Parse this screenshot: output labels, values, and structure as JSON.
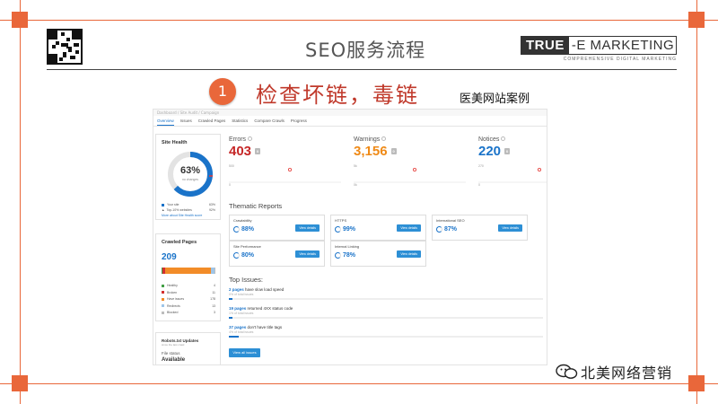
{
  "slide": {
    "title": "SEO服务流程",
    "brand_part1": "TRUE",
    "brand_part2": "-E MARKETING",
    "brand_sub": "COMPREHENSIVE DIGITAL MARKETING",
    "step_number": "1",
    "step_title": "检查坏链，毒链",
    "case_label": "医美网站案例",
    "watermark": "北美网络营销",
    "accent_color": "#e9673a"
  },
  "screenshot": {
    "breadcrumb": "Dashboard  /  Site Audit  /  Campaign",
    "tabs": [
      "Overview",
      "Issues",
      "Crawled Pages",
      "Statistics",
      "Compare Crawls",
      "Progress"
    ],
    "active_tab": 0,
    "site_health": {
      "label": "Site Health",
      "percent": 63,
      "percent_label": "63%",
      "sub": "no changes",
      "legend": [
        {
          "label": "Your site",
          "value": "63%",
          "color": "#1a73c9"
        },
        {
          "label": "Top-10% websites",
          "value": "92%",
          "color": "#4caf50"
        }
      ],
      "link": "More about Site Health score"
    },
    "crawled_pages": {
      "label": "Crawled Pages",
      "count": "209",
      "segments": [
        {
          "label": "Healthy",
          "value": "4",
          "color": "#43a047"
        },
        {
          "label": "Broken",
          "value": "11",
          "color": "#d32f2f"
        },
        {
          "label": "Have issues",
          "value": "178",
          "color": "#f28c28"
        },
        {
          "label": "Redirects",
          "value": "13",
          "color": "#9ec5e8"
        },
        {
          "label": "Blocked",
          "value": "3",
          "color": "#bdbdbd"
        }
      ]
    },
    "robots": {
      "label": "Robots.txt Updates",
      "sub": "since the last crawl",
      "file_status": "File status",
      "status": "Available"
    },
    "metrics": [
      {
        "label": "Errors",
        "value": "403",
        "color": "#c62828",
        "axis_top": "500",
        "axis_bottom": "0"
      },
      {
        "label": "Warnings",
        "value": "3,156",
        "color": "#ef8a17",
        "axis_top": "5k",
        "axis_bottom": "0k"
      },
      {
        "label": "Notices",
        "value": "220",
        "color": "#1a73c9",
        "axis_top": "270",
        "axis_bottom": "0"
      }
    ],
    "thematic": {
      "title": "Thematic Reports",
      "button_label": "View details",
      "cards": [
        {
          "name": "Crawlability",
          "pct": "88%",
          "value": 88
        },
        {
          "name": "HTTPS",
          "pct": "99%",
          "value": 99
        },
        {
          "name": "International SEO",
          "pct": "87%",
          "value": 87
        },
        {
          "name": "Site Performance",
          "pct": "80%",
          "value": 80
        },
        {
          "name": "Internal Linking",
          "pct": "78%",
          "value": 78
        }
      ]
    },
    "top_issues": {
      "title": "Top Issues:",
      "items": [
        {
          "count": "2 pages",
          "text": "have slow load speed",
          "share": "0% of total issues",
          "fill": 1
        },
        {
          "count": "19 pages",
          "text": "returned 4XX status code",
          "share": "1% of total issues",
          "fill": 1
        },
        {
          "count": "37 pages",
          "text": "don't have title tags",
          "share": "4% of total issues",
          "fill": 3
        }
      ],
      "button_label": "View all issues"
    }
  }
}
